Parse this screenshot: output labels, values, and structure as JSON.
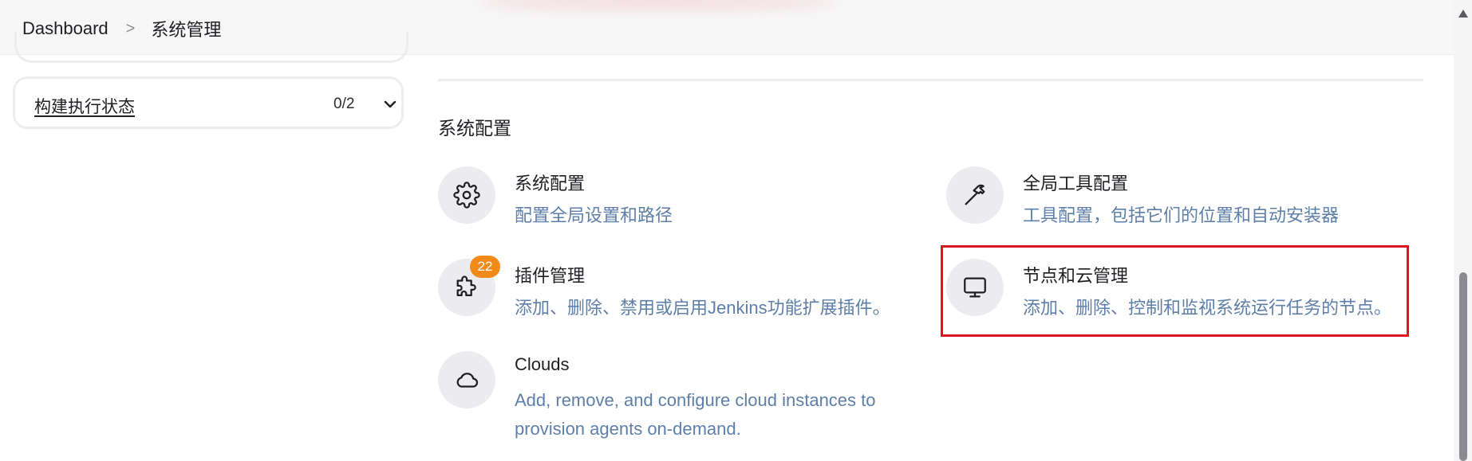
{
  "breadcrumb": {
    "items": [
      "Dashboard",
      "系统管理"
    ],
    "separator": ">"
  },
  "sidebar": {
    "executor_status": {
      "label": "构建执行状态",
      "count": "0/2"
    }
  },
  "section": {
    "title": "系统配置"
  },
  "items": [
    {
      "title": "系统配置",
      "description": "配置全局设置和路径",
      "icon": "gear-icon"
    },
    {
      "title": "全局工具配置",
      "description": "工具配置，包括它们的位置和自动安装器",
      "icon": "hammer-icon"
    },
    {
      "title": "插件管理",
      "description": "添加、删除、禁用或启用Jenkins功能扩展插件。",
      "icon": "puzzle-icon",
      "badge": "22"
    },
    {
      "title": "节点和云管理",
      "description": "添加、删除、控制和监视系统运行任务的节点。",
      "icon": "monitor-icon",
      "highlighted": true
    },
    {
      "title": "Clouds",
      "description": "Add, remove, and configure cloud instances to provision agents on-demand.",
      "icon": "cloud-icon"
    }
  ],
  "colors": {
    "description": "#5e7fa8",
    "badge": "#f28a1a",
    "highlight": "#e2151f",
    "icon_circle": "#ececf0"
  }
}
